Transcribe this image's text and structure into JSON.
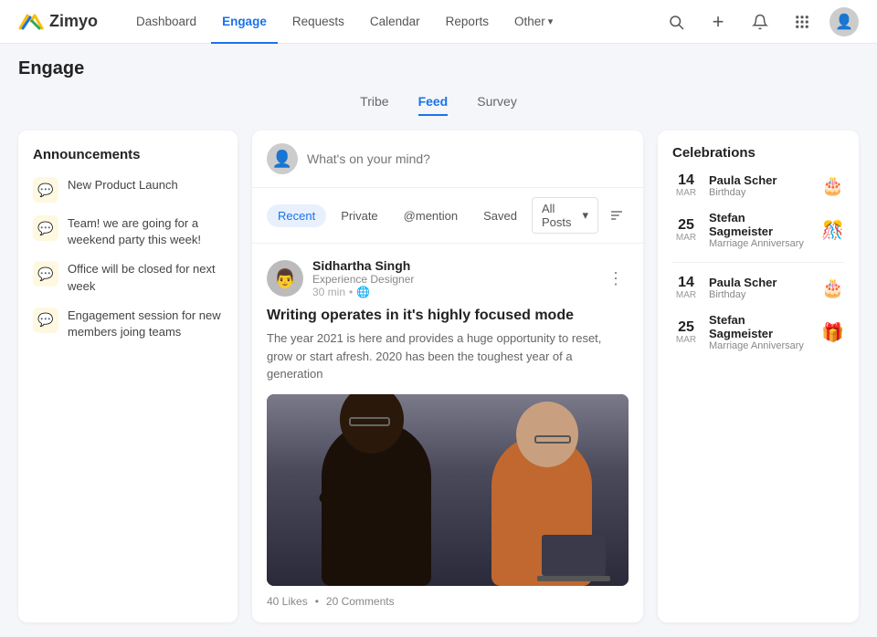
{
  "logo": {
    "name": "Zimyo",
    "icon_label": "zimyo-logo-icon"
  },
  "nav": {
    "links": [
      {
        "label": "Dashboard",
        "active": false
      },
      {
        "label": "Engage",
        "active": true
      },
      {
        "label": "Requests",
        "active": false
      },
      {
        "label": "Calendar",
        "active": false
      },
      {
        "label": "Reports",
        "active": false
      },
      {
        "label": "Other",
        "active": false,
        "has_dropdown": true
      }
    ]
  },
  "sub_tabs": [
    {
      "label": "Tribe",
      "active": false
    },
    {
      "label": "Feed",
      "active": true
    },
    {
      "label": "Survey",
      "active": false
    }
  ],
  "page_title": "Engage",
  "announcements": {
    "title": "Announcements",
    "items": [
      {
        "text": "New Product Launch"
      },
      {
        "text": "Team! we are going for a weekend party this week!"
      },
      {
        "text": "Office will be closed for next week"
      },
      {
        "text": "Engagement session for new members joing teams"
      }
    ]
  },
  "composer": {
    "placeholder": "What's on your mind?"
  },
  "filter_tabs": [
    {
      "label": "Recent",
      "active": true
    },
    {
      "label": "Private",
      "active": false
    },
    {
      "label": "@mention",
      "active": false
    },
    {
      "label": "Saved",
      "active": false
    }
  ],
  "all_posts_label": "All Posts",
  "post": {
    "author_name": "Sidhartha Singh",
    "author_role": "Experience Designer",
    "time": "30 min",
    "title": "Writing operates in it's highly focused mode",
    "excerpt": "The year 2021 is here and provides a huge opportunity to reset, grow or start afresh. 2020 has been the toughest year of a generation",
    "likes": "40 Likes",
    "comments": "20 Comments"
  },
  "celebrations": {
    "title": "Celebrations",
    "items": [
      {
        "date": "14",
        "month": "Mar",
        "name": "Paula Scher",
        "type": "Birthday",
        "emoji": "🎂"
      },
      {
        "date": "25",
        "month": "Mar",
        "name": "Stefan Sagmeister",
        "type": "Marriage Anniversary",
        "emoji": "🎊"
      },
      {
        "date": "14",
        "month": "Mar",
        "name": "Paula Scher",
        "type": "Birthday",
        "emoji": "🎂"
      },
      {
        "date": "25",
        "month": "Mar",
        "name": "Stefan Sagmeister",
        "type": "Marriage Anniversary",
        "emoji": "🎁"
      }
    ]
  }
}
